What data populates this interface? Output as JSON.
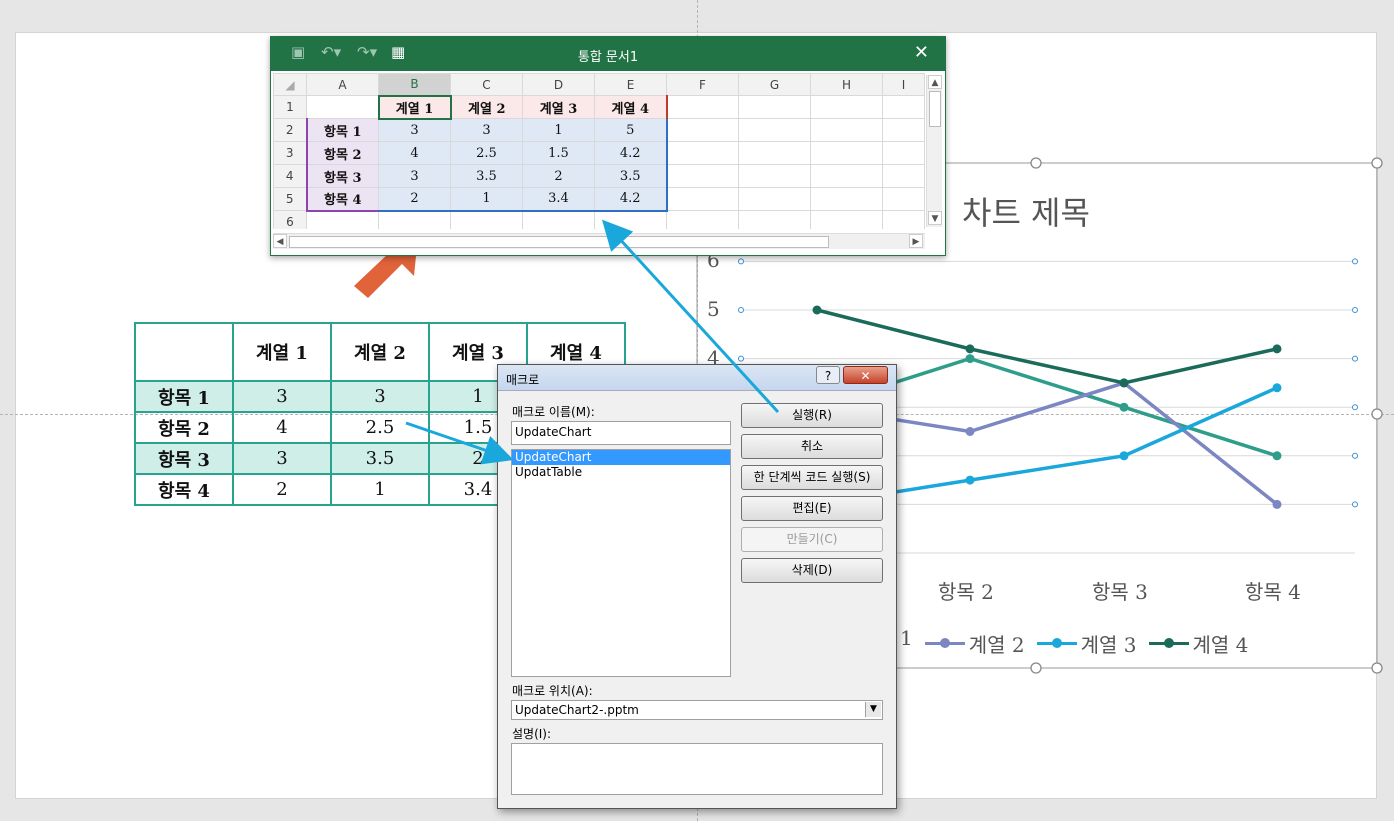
{
  "excel": {
    "title": "통합 문서1",
    "close_glyph": "✕",
    "col_headers": [
      "A",
      "B",
      "C",
      "D",
      "E",
      "F",
      "G",
      "H",
      "I"
    ],
    "row_numbers": [
      "1",
      "2",
      "3",
      "4",
      "5",
      "6"
    ],
    "series_headers": [
      "계열 1",
      "계열 2",
      "계열 3",
      "계열 4"
    ],
    "rows": [
      {
        "label": "항목 1",
        "values": [
          "3",
          "3",
          "1",
          "5"
        ]
      },
      {
        "label": "항목 2",
        "values": [
          "4",
          "2.5",
          "1.5",
          "4.2"
        ]
      },
      {
        "label": "항목 3",
        "values": [
          "3",
          "3.5",
          "2",
          "3.5"
        ]
      },
      {
        "label": "항목 4",
        "values": [
          "2",
          "1",
          "3.4",
          "4.2"
        ]
      }
    ]
  },
  "slide_table": {
    "headers": [
      "계열 1",
      "계열 2",
      "계열 3",
      "계열 4"
    ],
    "rows": [
      {
        "label": "항목 1",
        "values": [
          "3",
          "3",
          "1"
        ]
      },
      {
        "label": "항목 2",
        "values": [
          "4",
          "2.5",
          "1.5"
        ]
      },
      {
        "label": "항목 3",
        "values": [
          "3",
          "3.5",
          "2"
        ]
      },
      {
        "label": "항목 4",
        "values": [
          "2",
          "1",
          "3.4"
        ]
      }
    ]
  },
  "chart_data": {
    "type": "line",
    "title": "차트 제목",
    "categories": [
      "항목 1",
      "항목 2",
      "항목 3",
      "항목 4"
    ],
    "visible_categories": [
      "항목 2",
      "항목 3",
      "항목 4"
    ],
    "y_ticks_visible": [
      "6",
      "5",
      "4"
    ],
    "ylim": [
      0,
      6
    ],
    "series": [
      {
        "name": "계열 1",
        "color": "#2e9e8a",
        "values": [
          3,
          4,
          3,
          2
        ]
      },
      {
        "name": "계열 2",
        "color": "#7b86c2",
        "values": [
          3,
          2.5,
          3.5,
          1
        ]
      },
      {
        "name": "계열 3",
        "color": "#1aa7db",
        "values": [
          1,
          1.5,
          2,
          3.4
        ]
      },
      {
        "name": "계열 4",
        "color": "#1b6b5a",
        "values": [
          5,
          4.2,
          3.5,
          4.2
        ]
      }
    ],
    "legend_visible": [
      {
        "name": "계열 2",
        "color": "#7b86c2"
      },
      {
        "name": "계열 3",
        "color": "#1aa7db"
      },
      {
        "name": "계열 4",
        "color": "#1b6b5a"
      }
    ],
    "legend_cut_char": "1",
    "legend_position": "bottom",
    "grid": true
  },
  "dialog": {
    "title": "매크로",
    "help_glyph": "?",
    "close_glyph": "✕",
    "name_label": "매크로 이름(M):",
    "name_value": "UpdateChart",
    "macros": [
      "UpdateChart",
      "UpdatTable"
    ],
    "selected_macro": "UpdateChart",
    "buttons": {
      "run": "실행(R)",
      "cancel": "취소",
      "step": "한 단계씩 코드 실행(S)",
      "edit": "편집(E)",
      "create": "만들기(C)",
      "delete": "삭제(D)"
    },
    "location_label": "매크로 위치(A):",
    "location_value": "UpdateChart2-.pptm",
    "desc_label": "설명(I):",
    "desc_value": ""
  },
  "colors": {
    "excel_green": "#217346",
    "table_border": "#27a38f",
    "arrow_blue": "#1aa7db",
    "arrow_orange": "#e0633a"
  }
}
